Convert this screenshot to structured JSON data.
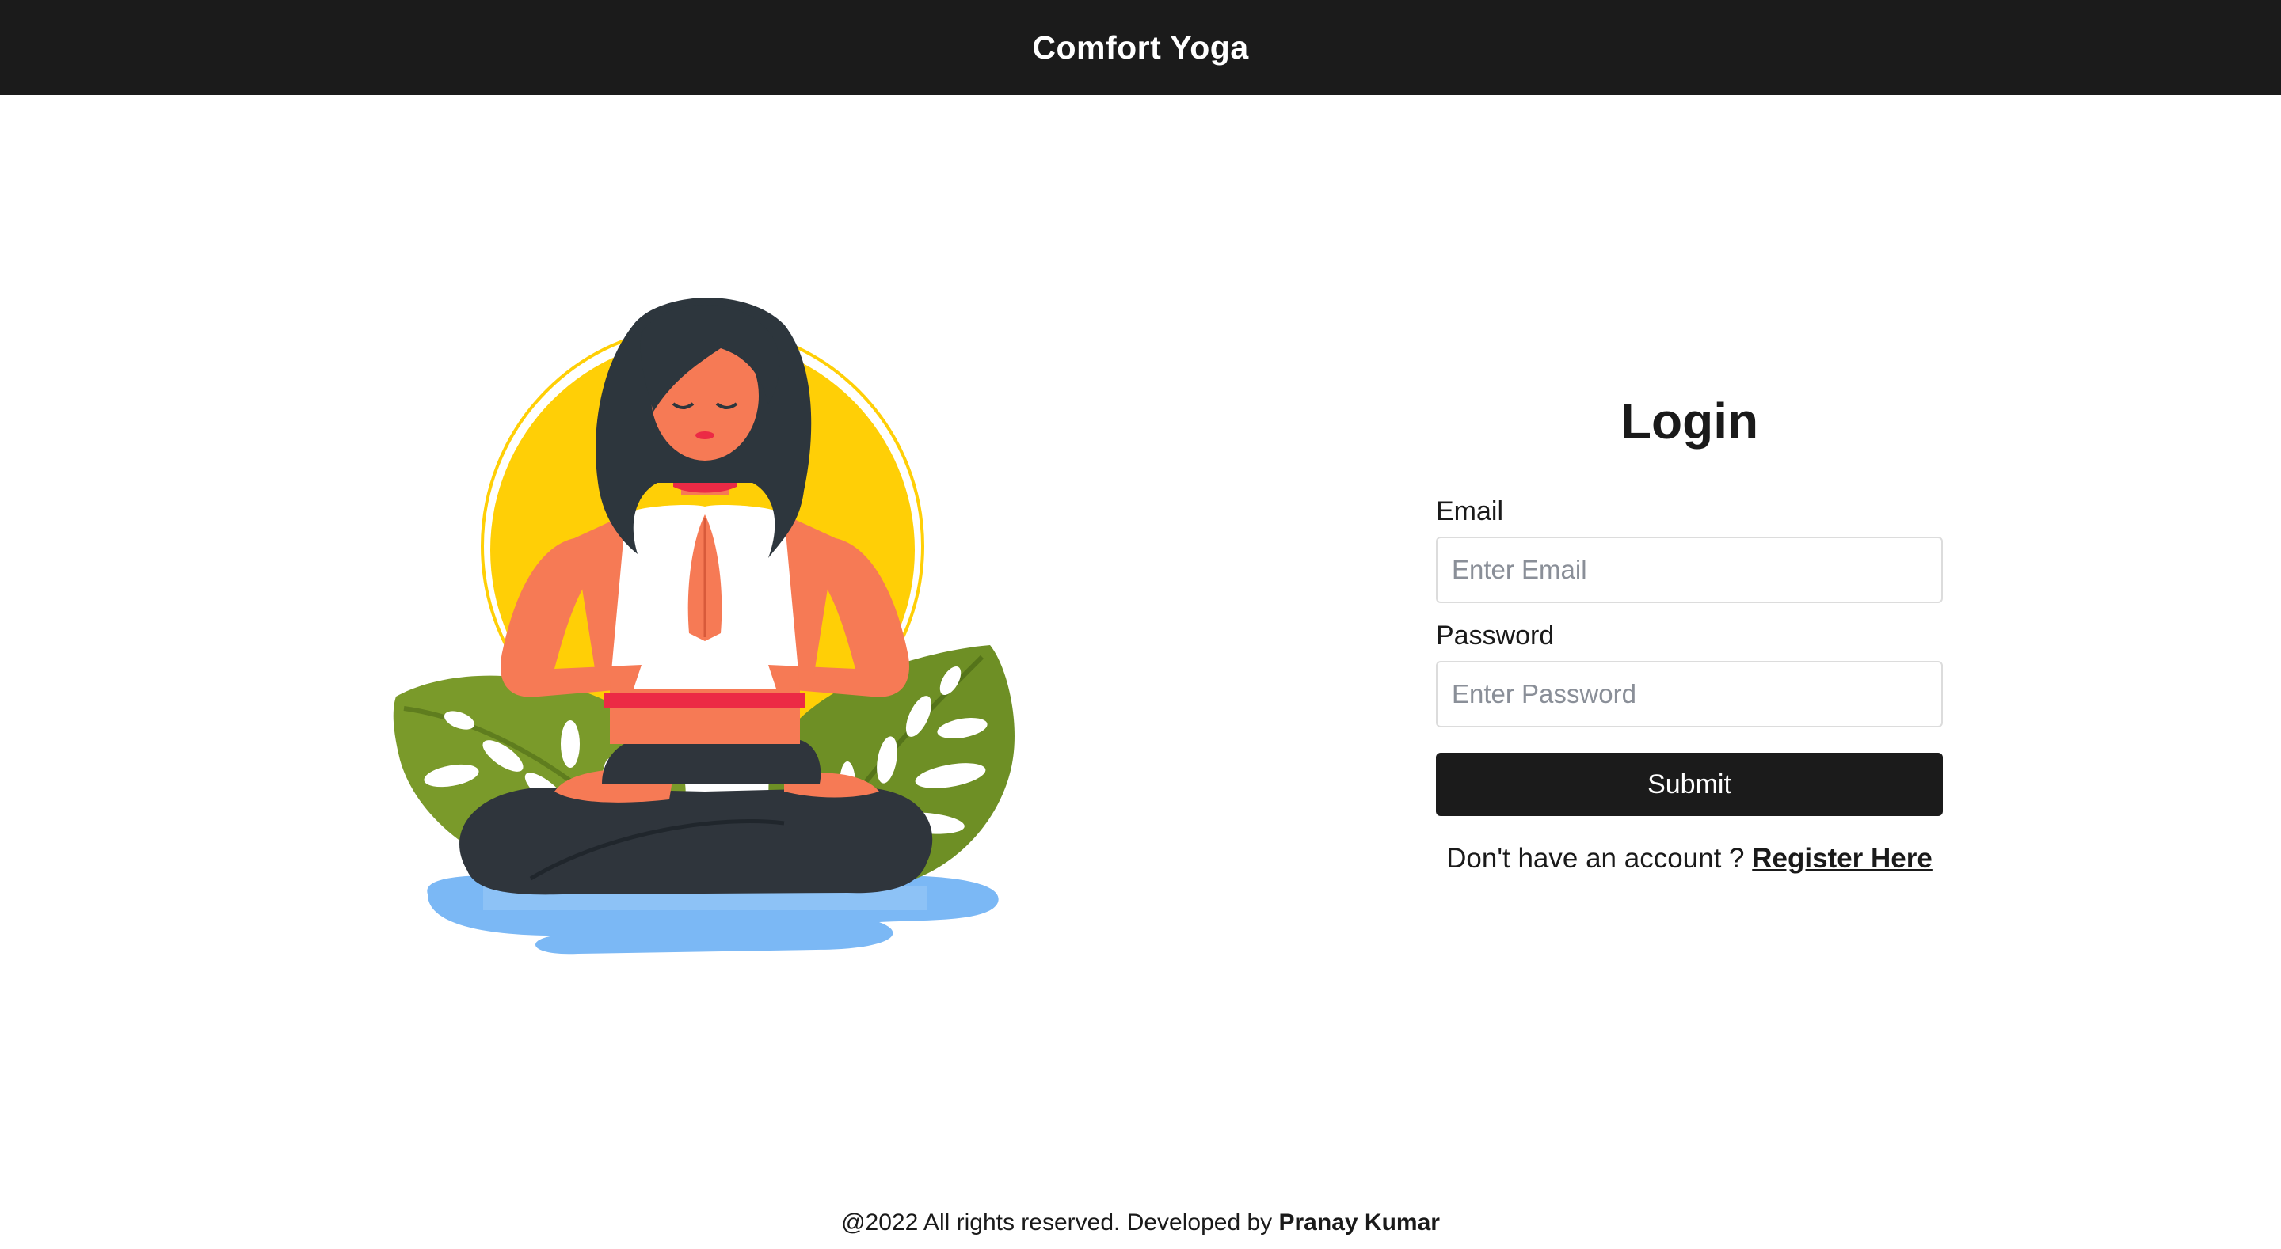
{
  "header": {
    "brand": "Comfort Yoga"
  },
  "illustration": {
    "alt": "woman-meditating-yoga"
  },
  "login": {
    "title": "Login",
    "email_label": "Email",
    "email_placeholder": "Enter Email",
    "email_value": "",
    "password_label": "Password",
    "password_placeholder": "Enter Password",
    "password_value": "",
    "submit_label": "Submit",
    "register_prompt": "Don't have an account ?",
    "register_link": "Register Here"
  },
  "footer": {
    "text": "@2022 All rights reserved. Developed by",
    "author": "Pranay Kumar"
  },
  "colors": {
    "header_bg": "#1b1b1b",
    "button_bg": "#1b1b1b",
    "sun": "#ffcf06",
    "leaf": "#7a9a2a",
    "water": "#7bb8f5",
    "skin": "#f67a55",
    "hair": "#2d363d"
  }
}
